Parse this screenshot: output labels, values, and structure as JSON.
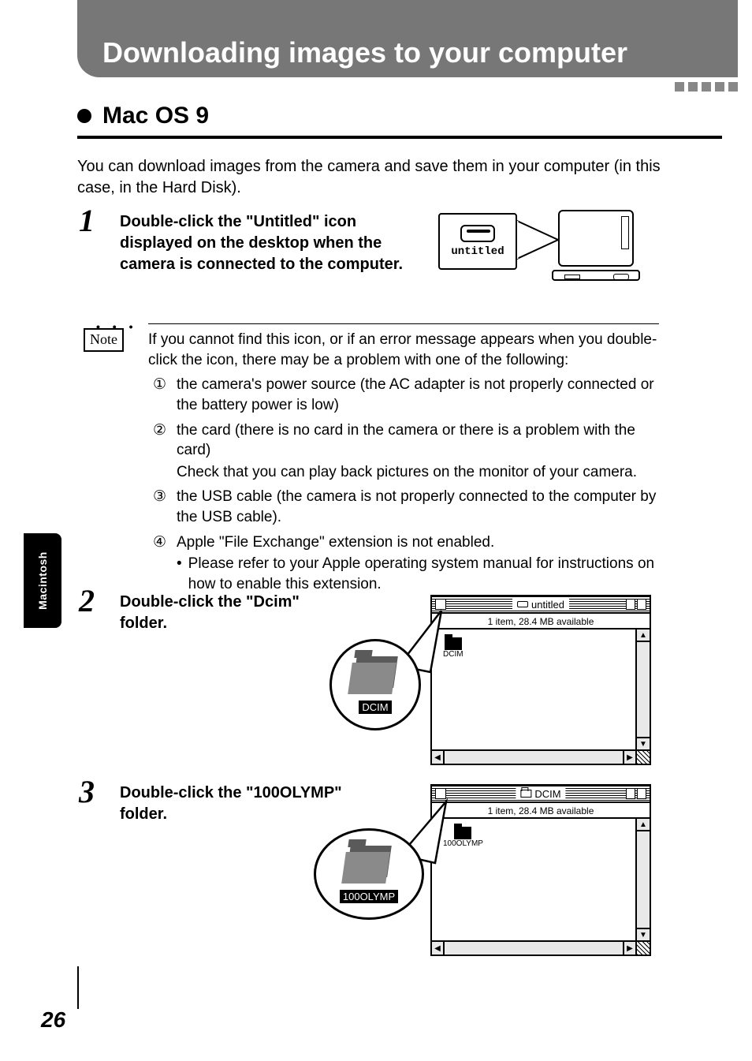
{
  "header": {
    "title": "Downloading images to your computer"
  },
  "section": {
    "title": "Mac OS 9"
  },
  "intro": "You can download images from the camera and save them in your computer (in this case, in the Hard Disk).",
  "steps": {
    "s1": {
      "num": "1",
      "text": "Double-click the \"Untitled\" icon displayed on the desktop when the camera is connected to the computer."
    },
    "s2": {
      "num": "2",
      "text": "Double-click the \"Dcim\" folder."
    },
    "s3": {
      "num": "3",
      "text": "Double-click the \"100OLYMP\" folder."
    }
  },
  "fig1": {
    "drive_label": "untitled"
  },
  "note": {
    "label": "Note",
    "intro": "If you cannot find this icon, or if an error message appears when you double-click the icon, there may be a problem with one of the following:",
    "items": [
      {
        "mk": "①",
        "text": "the camera's power source (the AC adapter is not properly connected or the battery power is low)"
      },
      {
        "mk": "②",
        "text": "the card (there is no card in the camera or there is a problem with the card)",
        "sub": "Check that you can play back pictures on the monitor of your camera."
      },
      {
        "mk": "③",
        "text": "the USB cable (the camera is not properly connected to the computer by the USB cable)."
      },
      {
        "mk": "④",
        "text": "Apple \"File Exchange\" extension is not enabled.",
        "sub_bullet": "Please refer to your Apple operating system manual for instructions on how to enable this extension."
      }
    ]
  },
  "finder2": {
    "title": "untitled",
    "status": "1 item, 28.4 MB available",
    "icon_label": "DCIM",
    "callout_label": "DCIM"
  },
  "finder3": {
    "title": "DCIM",
    "status": "1 item, 28.4 MB available",
    "icon_label": "100OLYMP",
    "callout_label": "100OLYMP"
  },
  "side_tab": "Macintosh",
  "page_number": "26"
}
